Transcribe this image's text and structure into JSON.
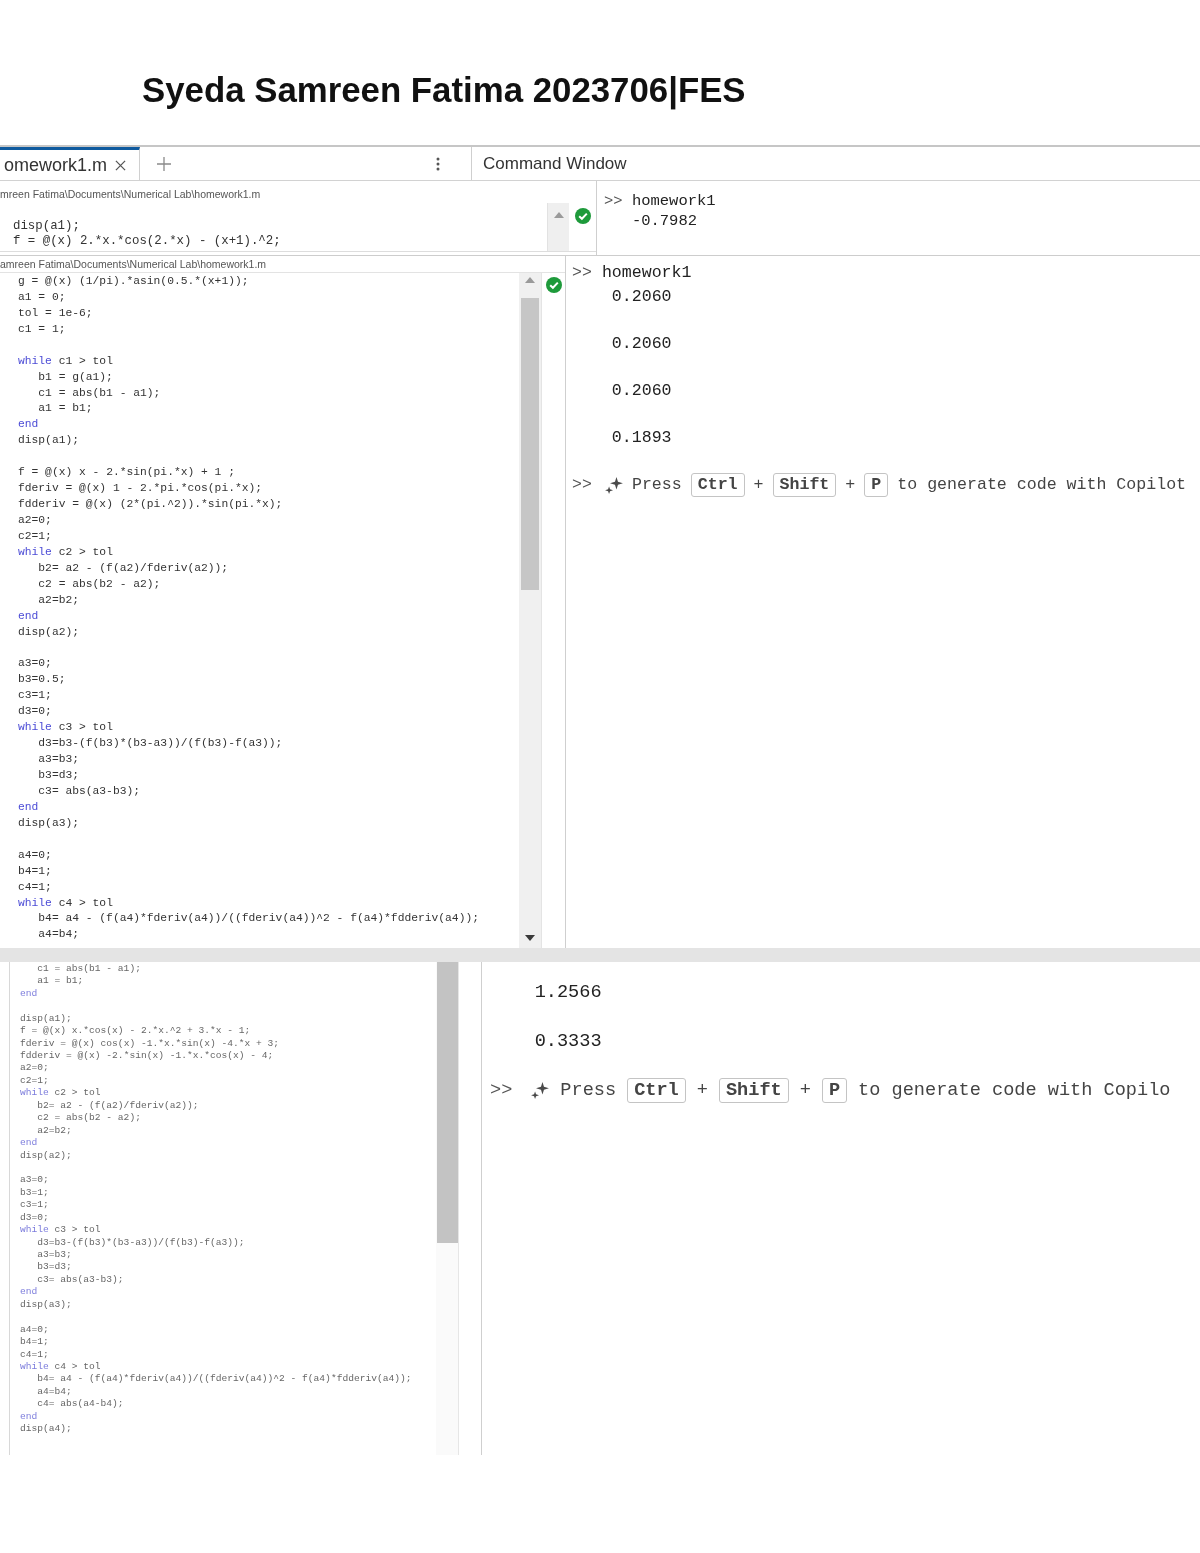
{
  "title": "Syeda Samreen Fatima 2023706|FES",
  "captures": [
    {
      "kind": "strip",
      "tab_bar": {
        "tabs": [
          {
            "label": "omework1.m",
            "selected": true
          }
        ]
      },
      "command_title": "Command Window",
      "editor": {
        "file_path": "mreen Fatima\\Documents\\Numerical Lab\\homework1.m",
        "blocks": [
          {
            "lines": [
              {
                "code": "disp(a1);"
              },
              {
                "code": "f = @(x) 2.*x.*cos(2.*x) - (x+1).^2;"
              }
            ]
          }
        ]
      },
      "command_window": {
        "entries": [
          {
            "kind": "command",
            "prompt": ">>",
            "text": "homework1"
          },
          {
            "kind": "output",
            "text": "-0.7982"
          }
        ]
      }
    },
    {
      "kind": "full",
      "editor": {
        "file_path": "amreen Fatima\\Documents\\Numerical Lab\\homework1.m",
        "blocks": [
          {
            "lines": [
              {
                "code": "g = @(x) (1/pi).*asin(0.5.*(x+1));"
              },
              {
                "code": "a1 = 0;"
              },
              {
                "code": "tol = 1e-6;"
              },
              {
                "code": "c1 = 1;"
              }
            ]
          },
          {
            "lines": [
              {
                "keyword": "while",
                "code": "c1 > tol",
                "children": [
                  {
                    "code": "b1 = g(a1);"
                  },
                  {
                    "code": "c1 = abs(b1 - a1);"
                  },
                  {
                    "code": "a1 = b1;"
                  }
                ]
              },
              {
                "keyword": "end"
              },
              {
                "code": "disp(a1);"
              }
            ]
          },
          {
            "lines": [
              {
                "code": "f = @(x) x - 2.*sin(pi.*x) + 1 ;"
              },
              {
                "code": "fderiv = @(x) 1 - 2.*pi.*cos(pi.*x);"
              },
              {
                "code": "fdderiv = @(x) (2*(pi.^2)).*sin(pi.*x);"
              },
              {
                "code": "a2=0;"
              },
              {
                "code": "c2=1;"
              },
              {
                "keyword": "while",
                "code": "c2 > tol",
                "children": [
                  {
                    "code": "b2= a2 - (f(a2)/fderiv(a2));"
                  },
                  {
                    "code": "c2 = abs(b2 - a2);"
                  },
                  {
                    "code": "a2=b2;"
                  }
                ]
              },
              {
                "keyword": "end"
              },
              {
                "code": "disp(a2);"
              }
            ]
          },
          {
            "lines": [
              {
                "code": "a3=0;"
              },
              {
                "code": "b3=0.5;"
              },
              {
                "code": "c3=1;"
              },
              {
                "code": "d3=0;"
              },
              {
                "keyword": "while",
                "code": "c3 > tol",
                "children": [
                  {
                    "code": "d3=b3-(f(b3)*(b3-a3))/(f(b3)-f(a3));"
                  },
                  {
                    "code": "a3=b3;"
                  },
                  {
                    "code": "b3=d3;"
                  },
                  {
                    "code": "c3= abs(a3-b3);"
                  }
                ]
              },
              {
                "keyword": "end"
              },
              {
                "code": "disp(a3);"
              }
            ]
          },
          {
            "lines": [
              {
                "code": "a4=0;"
              },
              {
                "code": "b4=1;"
              },
              {
                "code": "c4=1;"
              },
              {
                "keyword": "while",
                "code": "c4 > tol",
                "children": [
                  {
                    "code": "b4= a4 - (f(a4)*fderiv(a4))/((fderiv(a4))^2 - f(a4)*fdderiv(a4));"
                  },
                  {
                    "code": "a4=b4;"
                  }
                ]
              }
            ]
          }
        ]
      },
      "command_window": {
        "entries": [
          {
            "kind": "command",
            "prompt": ">>",
            "text": "homework1"
          },
          {
            "kind": "output",
            "text": "0.2060"
          },
          {
            "kind": "output",
            "text": "0.2060"
          },
          {
            "kind": "output",
            "text": "0.2060"
          },
          {
            "kind": "output",
            "text": "0.1893"
          },
          {
            "kind": "hint",
            "prompt": ">>",
            "parts": [
              {
                "kind": "text",
                "text": "Press"
              },
              {
                "kind": "key",
                "text": "Ctrl"
              },
              {
                "kind": "text",
                "text": "+"
              },
              {
                "kind": "key",
                "text": "Shift"
              },
              {
                "kind": "text",
                "text": "+"
              },
              {
                "kind": "key",
                "text": "P"
              },
              {
                "kind": "text",
                "text": "to generate code with Copilot"
              }
            ]
          }
        ]
      }
    },
    {
      "kind": "lower",
      "editor": {
        "blocks": [
          {
            "lines": [
              {
                "children": [
                  {
                    "code": "c1 = abs(b1 - a1);"
                  },
                  {
                    "code": "a1 = b1;"
                  }
                ]
              },
              {
                "keyword": "end"
              }
            ]
          },
          {
            "lines": [
              {
                "code": "disp(a1);"
              },
              {
                "code": "f = @(x) x.*cos(x) - 2.*x.^2 + 3.*x - 1;"
              },
              {
                "code": "fderiv = @(x) cos(x) -1.*x.*sin(x) -4.*x + 3;"
              },
              {
                "code": "fdderiv = @(x) -2.*sin(x) -1.*x.*cos(x) - 4;"
              },
              {
                "code": "a2=0;"
              },
              {
                "code": "c2=1;"
              },
              {
                "keyword": "while",
                "code": "c2 > tol",
                "children": [
                  {
                    "code": "b2= a2 - (f(a2)/fderiv(a2));"
                  },
                  {
                    "code": "c2 = abs(b2 - a2);"
                  },
                  {
                    "code": "a2=b2;"
                  }
                ]
              },
              {
                "keyword": "end"
              },
              {
                "code": "disp(a2);"
              }
            ]
          },
          {
            "lines": [
              {
                "code": "a3=0;"
              },
              {
                "code": "b3=1;"
              },
              {
                "code": "c3=1;"
              },
              {
                "code": "d3=0;"
              },
              {
                "keyword": "while",
                "code": "c3 > tol",
                "children": [
                  {
                    "code": "d3=b3-(f(b3)*(b3-a3))/(f(b3)-f(a3));"
                  },
                  {
                    "code": "a3=b3;"
                  },
                  {
                    "code": "b3=d3;"
                  },
                  {
                    "code": "c3= abs(a3-b3);"
                  }
                ]
              },
              {
                "keyword": "end"
              },
              {
                "code": "disp(a3);"
              }
            ]
          },
          {
            "lines": [
              {
                "code": "a4=0;"
              },
              {
                "code": "b4=1;"
              },
              {
                "code": "c4=1;"
              },
              {
                "keyword": "while",
                "code": "c4 > tol",
                "children": [
                  {
                    "code": "b4= a4 - (f(a4)*fderiv(a4))/((fderiv(a4))^2 - f(a4)*fdderiv(a4));"
                  },
                  {
                    "code": "a4=b4;"
                  },
                  {
                    "code": "c4= abs(a4-b4);"
                  }
                ]
              },
              {
                "keyword": "end"
              },
              {
                "code": "disp(a4);"
              }
            ]
          }
        ]
      },
      "command_window": {
        "entries": [
          {
            "kind": "output",
            "text": "1.2566"
          },
          {
            "kind": "output",
            "text": "0.3333"
          },
          {
            "kind": "hint",
            "prompt": ">>",
            "parts": [
              {
                "kind": "text",
                "text": "Press"
              },
              {
                "kind": "key",
                "text": "Ctrl"
              },
              {
                "kind": "text",
                "text": "+"
              },
              {
                "kind": "key",
                "text": "Shift"
              },
              {
                "kind": "text",
                "text": "+"
              },
              {
                "kind": "key",
                "text": "P"
              },
              {
                "kind": "text",
                "text": "to generate code with Copilo"
              }
            ]
          }
        ]
      }
    }
  ]
}
